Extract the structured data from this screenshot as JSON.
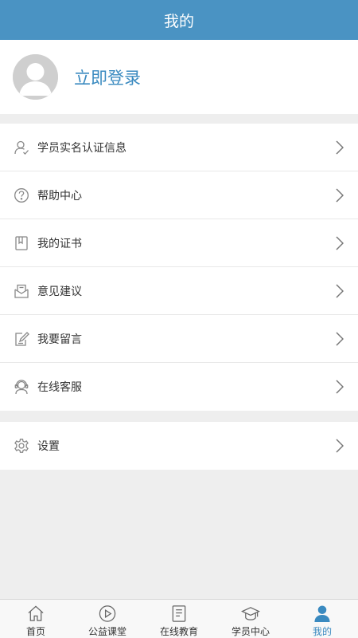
{
  "header": {
    "title": "我的"
  },
  "profile": {
    "login_label": "立即登录",
    "avatar_icon": "user-avatar-icon"
  },
  "menu": {
    "items": [
      {
        "label": "学员实名认证信息",
        "icon": "user-verify-icon"
      },
      {
        "label": "帮助中心",
        "icon": "question-icon"
      },
      {
        "label": "我的证书",
        "icon": "certificate-icon"
      },
      {
        "label": "意见建议",
        "icon": "feedback-icon"
      },
      {
        "label": "我要留言",
        "icon": "message-edit-icon"
      },
      {
        "label": "在线客服",
        "icon": "customer-service-icon"
      }
    ],
    "settings": {
      "label": "设置",
      "icon": "gear-icon"
    }
  },
  "tabbar": {
    "items": [
      {
        "label": "首页",
        "icon": "home-icon",
        "active": false
      },
      {
        "label": "公益课堂",
        "icon": "play-icon",
        "active": false
      },
      {
        "label": "在线教育",
        "icon": "book-icon",
        "active": false
      },
      {
        "label": "学员中心",
        "icon": "graduation-cap-icon",
        "active": false
      },
      {
        "label": "我的",
        "icon": "person-icon",
        "active": true
      }
    ]
  },
  "colors": {
    "brand": "#4a93c3",
    "accent_text": "#3a8ac0",
    "background": "#eeeeee"
  }
}
